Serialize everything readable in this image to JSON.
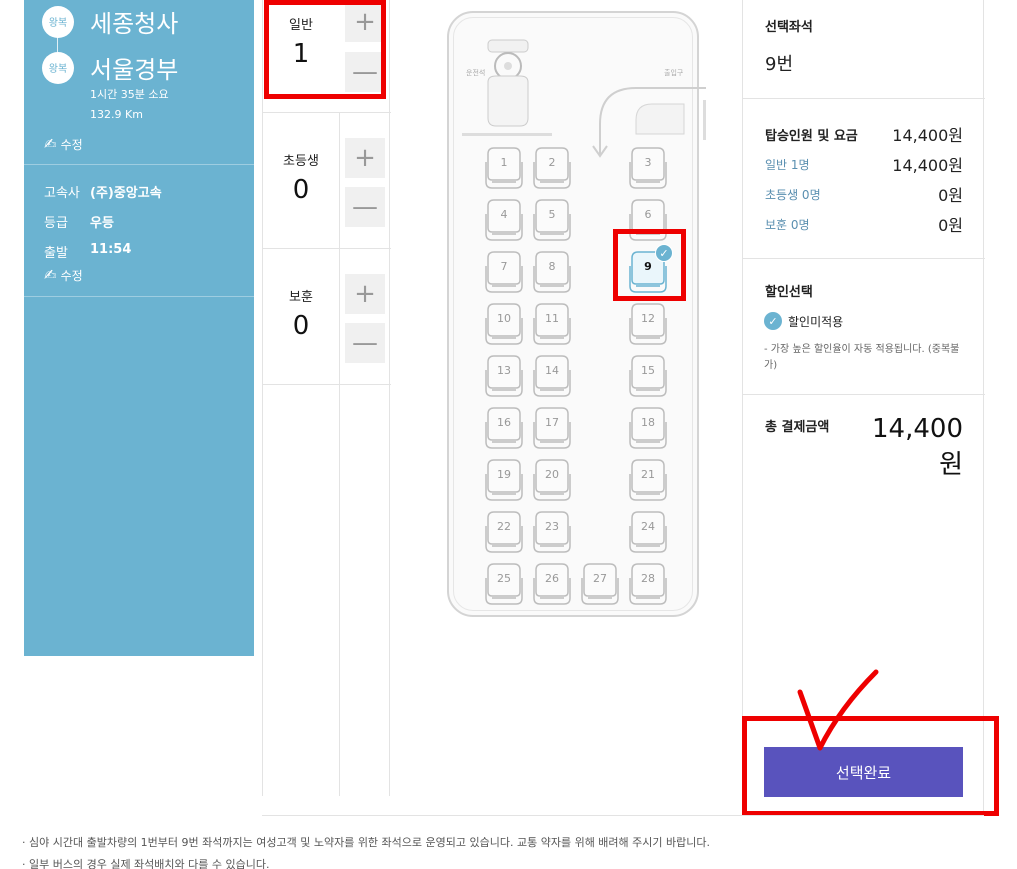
{
  "route": {
    "departure": {
      "badge": "왕복",
      "name": "세종청사"
    },
    "arrival": {
      "badge": "왕복",
      "name": "서울경부"
    },
    "duration": "1시간 35분 소요",
    "distance": "132.9 Km",
    "edit_label": "수정"
  },
  "trip": {
    "company_key": "고속사",
    "company_value": "(주)중앙고속",
    "grade_key": "등급",
    "grade_value": "우등",
    "depart_key": "출발",
    "depart_value": "11:54",
    "edit_label": "수정"
  },
  "passengers": {
    "adult": {
      "label": "일반",
      "count": "1"
    },
    "child": {
      "label": "초등생",
      "count": "0"
    },
    "veteran": {
      "label": "보훈",
      "count": "0"
    },
    "plus": "+",
    "minus": "—"
  },
  "bus": {
    "driver_label": "운전석",
    "door_label": "출입구",
    "seats": [
      "1",
      "2",
      "3",
      "4",
      "5",
      "6",
      "7",
      "8",
      "9",
      "10",
      "11",
      "12",
      "13",
      "14",
      "15",
      "16",
      "17",
      "18",
      "19",
      "20",
      "21",
      "22",
      "23",
      "24",
      "25",
      "26",
      "27",
      "28"
    ],
    "selected_seat": "9",
    "check_glyph": "✓"
  },
  "summary": {
    "selected_title": "선택좌석",
    "selected_value": "9번",
    "fare_title": "탑승인원 및 요금",
    "fare_total": "14,400원",
    "rows": [
      {
        "label": "일반 1명",
        "value": "14,400원"
      },
      {
        "label": "초등생 0명",
        "value": "0원"
      },
      {
        "label": "보훈 0명",
        "value": "0원"
      }
    ],
    "discount_title": "할인선택",
    "discount_option": "할인미적용",
    "discount_note": "- 가장 높은 할인율이 자동 적용됩니다. (중복불가)",
    "total_title": "총 결제금액",
    "total_value": "14,400원",
    "confirm_label": "선택완료"
  },
  "notices": [
    "· 심야 시간대 출발차량의 1번부터 9번 좌석까지는 여성고객 및 노약자를 위한 좌석으로 운영되고 있습니다. 교통 약자를 위해 배려해 주시기 바랍니다.",
    "· 일부 버스의 경우 실제 좌석배치와 다를 수 있습니다."
  ],
  "colors": {
    "panel": "#6bb3d1",
    "button": "#5953bd",
    "annotation": "#ee0000"
  }
}
